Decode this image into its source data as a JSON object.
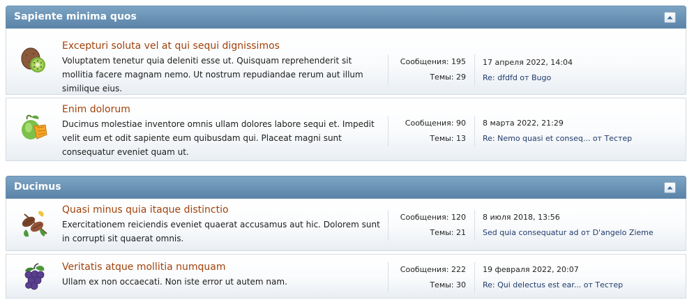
{
  "categories": [
    {
      "title": "Sapiente minima quos",
      "forums": [
        {
          "icon": "kiwi-icon",
          "title": "Excepturi soluta vel at qui sequi dignissimos",
          "description": "Voluptatem tenetur quia deleniti esse ut. Quisquam reprehenderit sit mollitia facere magnam nemo. Ut nostrum repudiandae rerum aut illum similique eius.",
          "messages": "Сообщения: 195",
          "topics": "Темы: 29",
          "last_date": "17 апреля 2022, 14:04",
          "last_post": "Re: dfdfd от Bugo"
        },
        {
          "icon": "mango-icon",
          "title": "Enim dolorum",
          "description": "Ducimus molestiae inventore omnis ullam dolores labore sequi et. Impedit velit eum et odit sapiente eum quibusdam qui. Placeat magni sunt consequatur eveniet quam ut.",
          "messages": "Сообщения: 90",
          "topics": "Темы: 13",
          "last_date": "8 марта 2022, 21:29",
          "last_post": "Re: Nemo quasi et conseq... от Тестер"
        }
      ]
    },
    {
      "title": "Ducimus",
      "forums": [
        {
          "icon": "cacao-icon",
          "title": "Quasi minus quia itaque distinctio",
          "description": "Exercitationem reiciendis eveniet quaerat accusamus aut hic. Dolorem sunt in corrupti sit quaerat omnis.",
          "messages": "Сообщения: 120",
          "topics": "Темы: 21",
          "last_date": "8 июля 2018, 13:56",
          "last_post": "Sed quia consequatur ad от D'angelo Zieme"
        },
        {
          "icon": "grapes-icon",
          "title": "Veritatis atque mollitia numquam",
          "description": "Ullam ex non occaecati. Non iste error ut autem nam.",
          "messages": "Сообщения: 222",
          "topics": "Темы: 30",
          "last_date": "19 февраля 2022, 20:07",
          "last_post": "Re: Qui delectus est ear... от Тестер"
        }
      ]
    }
  ],
  "colors": {
    "header_bg": "#5f88ad",
    "title_link": "#a0420b",
    "last_post_link": "#1f3a6b"
  }
}
